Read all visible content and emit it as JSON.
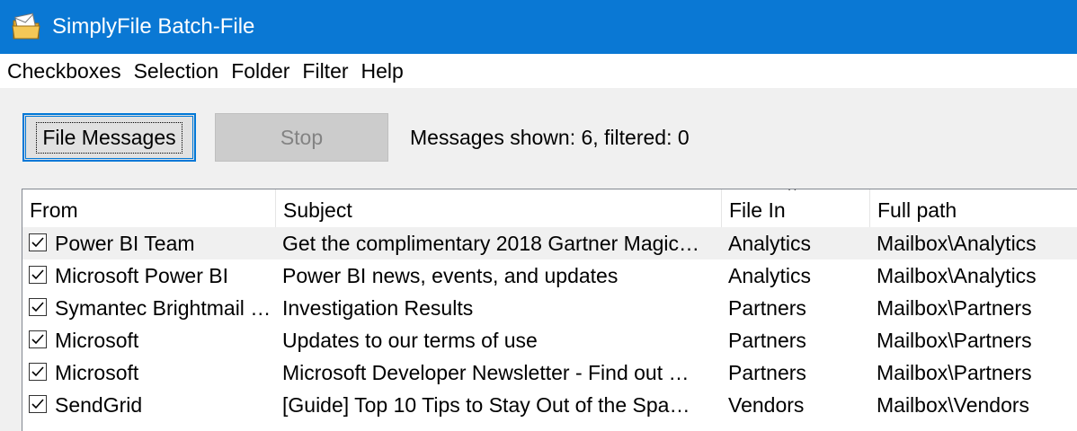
{
  "window": {
    "title": "SimplyFile Batch-File",
    "icon": "envelope-folder-icon"
  },
  "menu": [
    "Checkboxes",
    "Selection",
    "Folder",
    "Filter",
    "Help"
  ],
  "toolbar": {
    "file_messages_label": "File Messages",
    "stop_label": "Stop",
    "status": "Messages shown: 6, filtered: 0"
  },
  "list": {
    "columns": [
      "From",
      "Subject",
      "File In",
      "Full path"
    ],
    "sort_column": "File In",
    "rows": [
      {
        "checked": true,
        "from": "Power BI Team",
        "subject": "Get the complimentary 2018 Gartner Magic…",
        "file_in": "Analytics",
        "path": "Mailbox\\Analytics"
      },
      {
        "checked": true,
        "from": "Microsoft Power BI",
        "subject": "Power BI news, events, and updates",
        "file_in": "Analytics",
        "path": "Mailbox\\Analytics"
      },
      {
        "checked": true,
        "from": "Symantec Brightmail …",
        "subject": "Investigation Results",
        "file_in": "Partners",
        "path": "Mailbox\\Partners"
      },
      {
        "checked": true,
        "from": "Microsoft",
        "subject": "Updates to our terms of use",
        "file_in": "Partners",
        "path": "Mailbox\\Partners"
      },
      {
        "checked": true,
        "from": "Microsoft",
        "subject": "Microsoft Developer Newsletter - Find out …",
        "file_in": "Partners",
        "path": "Mailbox\\Partners"
      },
      {
        "checked": true,
        "from": "SendGrid",
        "subject": "[Guide] Top 10 Tips to Stay Out of the Spa…",
        "file_in": "Vendors",
        "path": "Mailbox\\Vendors"
      }
    ]
  }
}
